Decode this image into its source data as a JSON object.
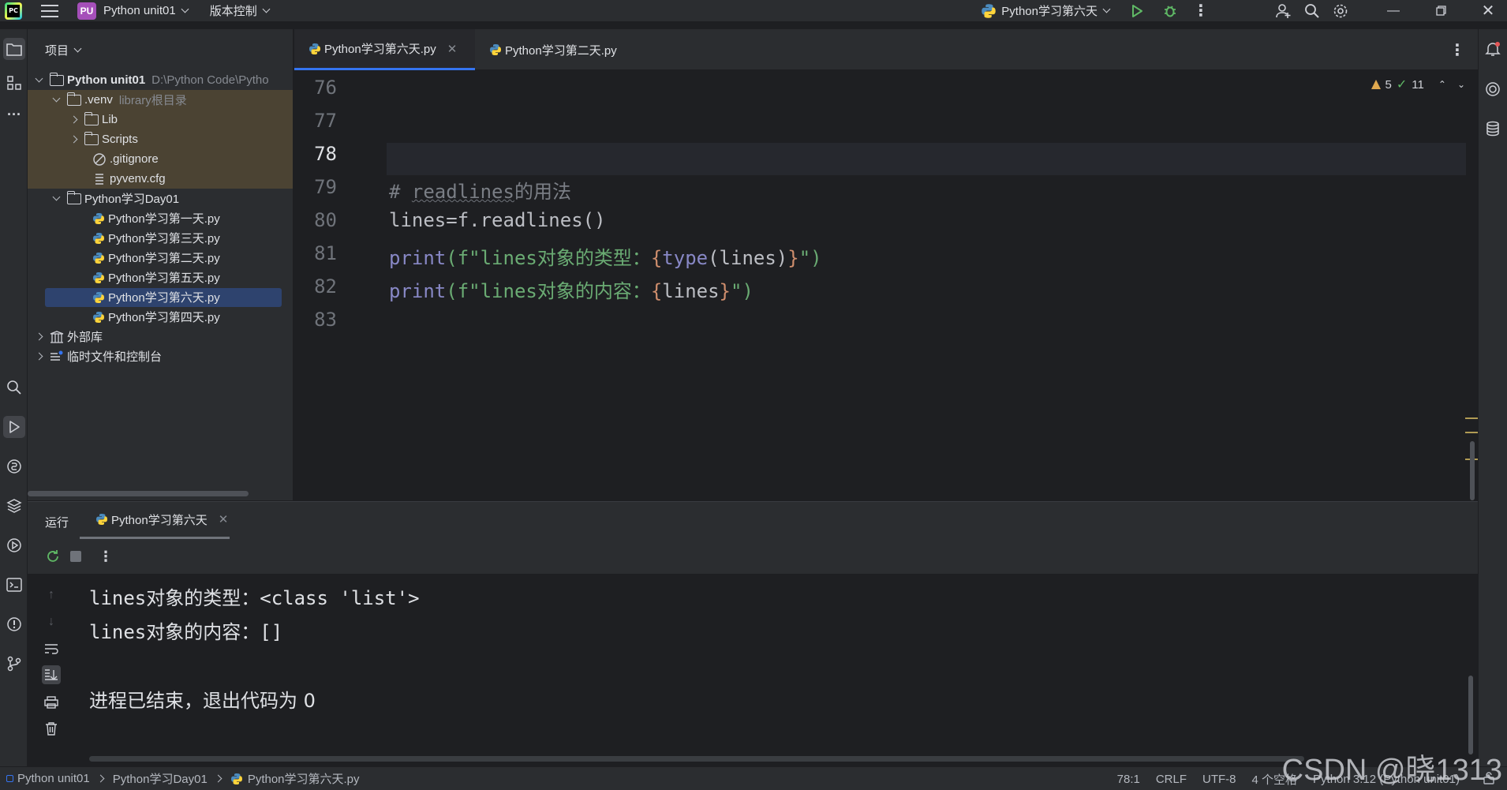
{
  "titlebar": {
    "project_badge": "PU",
    "project_name": "Python unit01",
    "vcs_menu": "版本控制",
    "run_config": "Python学习第六天"
  },
  "project_panel": {
    "header": "项目",
    "tree": [
      {
        "label": "Python unit01",
        "hint": "D:\\Python Code\\Pytho",
        "type": "folder",
        "expanded": true
      },
      {
        "label": ".venv",
        "hint": "library根目录",
        "type": "folder",
        "expanded": true
      },
      {
        "label": "Lib",
        "type": "folder",
        "expanded": false
      },
      {
        "label": "Scripts",
        "type": "folder",
        "expanded": false
      },
      {
        "label": ".gitignore",
        "type": "ignore-file"
      },
      {
        "label": "pyvenv.cfg",
        "type": "config-file"
      },
      {
        "label": "Python学习Day01",
        "type": "folder",
        "expanded": true
      },
      {
        "label": "Python学习第一天.py",
        "type": "python-file"
      },
      {
        "label": "Python学习第三天.py",
        "type": "python-file"
      },
      {
        "label": "Python学习第二天.py",
        "type": "python-file"
      },
      {
        "label": "Python学习第五天.py",
        "type": "python-file"
      },
      {
        "label": "Python学习第六天.py",
        "type": "python-file",
        "selected": true
      },
      {
        "label": "Python学习第四天.py",
        "type": "python-file"
      },
      {
        "label": "外部库",
        "type": "library"
      },
      {
        "label": "临时文件和控制台",
        "type": "scratches"
      }
    ]
  },
  "editor": {
    "tabs": [
      {
        "label": "Python学习第六天.py",
        "active": true
      },
      {
        "label": "Python学习第二天.py",
        "active": false
      }
    ],
    "inspections": {
      "warnings": "5",
      "ok": "11"
    },
    "line_numbers": [
      "76",
      "77",
      "78",
      "79",
      "80",
      "81",
      "82",
      "83"
    ],
    "current_line": "78",
    "code": {
      "l79_comment": "# ",
      "l79_word": "readlines",
      "l79_rest": "的用法",
      "l80": "lines=f.readlines()",
      "l81_fn": "print",
      "l81_str1": "(f\"lines对象的类型：",
      "l81_inner": "type",
      "l81_arg": "(lines)",
      "l81_tail": "\")",
      "l82_fn": "print",
      "l82_str1": "(f\"lines对象的内容：",
      "l82_arg": "lines",
      "l82_tail": "\")"
    }
  },
  "run_panel": {
    "title": "运行",
    "tab_label": "Python学习第六天",
    "output": [
      "lines对象的类型：<class 'list'>",
      "lines对象的内容：[]",
      "",
      "进程已结束，退出代码为 0"
    ]
  },
  "status_bar": {
    "breadcrumb": [
      "Python unit01",
      "Python学习Day01",
      "Python学习第六天.py"
    ],
    "position": "78:1",
    "line_ending": "CRLF",
    "encoding": "UTF-8",
    "indent": "4 个空格",
    "interpreter": "Python 3.12 (Python unit01)"
  },
  "watermark": "CSDN @晓1313",
  "colors": {
    "accent": "#3574f0",
    "selection": "#2e436e",
    "venv_highlight": "#4b4333",
    "string": "#6aab73",
    "builtin": "#8888c6",
    "brace": "#cf8e6d",
    "run_green": "#5fb865"
  }
}
